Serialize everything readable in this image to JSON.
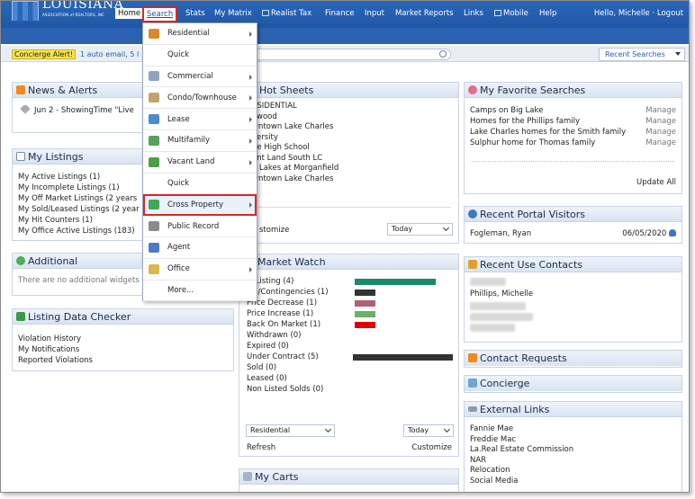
{
  "logo": {
    "name": "LOUISIANA",
    "tagline": "ASSOCIATION of REALTORS, INC"
  },
  "nav": {
    "home": "Home",
    "search": "Search",
    "stats": "Stats",
    "my_matrix": "My Matrix",
    "realist_tax": "Realist Tax",
    "finance": "Finance",
    "input": "Input",
    "market_reports": "Market Reports",
    "links": "Links",
    "mobile": "Mobile",
    "help": "Help",
    "greeting": "Hello, Michelle · Logout"
  },
  "alert": {
    "badge": "Concierge Alert!",
    "text": "1 auto email, 5 l"
  },
  "search_box": {
    "placeholder": ""
  },
  "recent_searches": "Recent Searches",
  "menu": [
    {
      "label": "Residential",
      "icon": "house-icon",
      "submenu": true
    },
    {
      "label": "Quick",
      "icon": "",
      "submenu": false
    },
    {
      "label": "Commercial",
      "icon": "building-icon",
      "submenu": true
    },
    {
      "label": "Condo/Townhouse",
      "icon": "condo-icon",
      "submenu": true
    },
    {
      "label": "Lease",
      "icon": "lease-icon",
      "submenu": true
    },
    {
      "label": "Multifamily",
      "icon": "multifamily-icon",
      "submenu": true
    },
    {
      "label": "Vacant Land",
      "icon": "tree-icon",
      "submenu": true
    },
    {
      "label": "Quick",
      "icon": "",
      "submenu": false
    },
    {
      "label": "Cross Property",
      "icon": "cross-arrows-icon",
      "submenu": true
    },
    {
      "label": "Public Record",
      "icon": "bank-icon",
      "submenu": false
    },
    {
      "label": "Agent",
      "icon": "agent-icon",
      "submenu": false
    },
    {
      "label": "Office",
      "icon": "office-icon",
      "submenu": true
    },
    {
      "label": "More...",
      "icon": "",
      "submenu": false
    }
  ],
  "news": {
    "title": "News & Alerts",
    "item": "Jun 2 - ShowingTime \"Live"
  },
  "listings": {
    "title": "My Listings",
    "items": [
      "My Active Listings (1)",
      "My Incomplete Listings (1)",
      "My Off Market Listings (2 years",
      "My Sold/Leased Listings (2 year",
      "My Hit Counters (1)",
      "My Office Active Listings (183)"
    ]
  },
  "additional": {
    "title": "Additional",
    "text": "There are no additional widgets"
  },
  "checker": {
    "title": "Listing Data Checker",
    "items": [
      "Violation History",
      "My Notifications",
      "Reported Violations"
    ]
  },
  "hotsheets": {
    "title": "Hot Sheets",
    "items": [
      "ESIDENTIAL",
      "ywood",
      "wntown Lake Charles",
      "versity",
      "be High School",
      "ant Land South LC",
      "e Lakes at Morganfield",
      "wntown Lake Charles"
    ],
    "customize": "stomize",
    "period": "Today"
  },
  "market": {
    "title": "Market Watch",
    "rows": [
      {
        "label": "w Listing (4)",
        "bar": 0.72,
        "color": "#1a8a6a"
      },
      {
        "label": "ive/Contingencies (1)",
        "bar": 0.18,
        "color": "#333333"
      },
      {
        "label": "Price Decrease (1)",
        "bar": 0.18,
        "color": "#b06070"
      },
      {
        "label": "Price Increase (1)",
        "bar": 0.18,
        "color": "#6ab06a"
      },
      {
        "label": "Back On Market (1)",
        "bar": 0.18,
        "color": "#e00000"
      },
      {
        "label": "Withdrawn (0)",
        "bar": 0,
        "color": "#333333"
      },
      {
        "label": "Expired (0)",
        "bar": 0,
        "color": "#333333"
      },
      {
        "label": "Under Contract (5)",
        "bar": 0.9,
        "color": "#333333"
      },
      {
        "label": "Sold (0)",
        "bar": 0,
        "color": "#333333"
      },
      {
        "label": "Leased (0)",
        "bar": 0,
        "color": "#333333"
      },
      {
        "label": "Non Listed Solds (0)",
        "bar": 0,
        "color": "#333333"
      }
    ],
    "type_select": "Residential",
    "period_select": "Today",
    "refresh": "Refresh",
    "customize": "Customize"
  },
  "carts": {
    "title": "My Carts"
  },
  "favorites": {
    "title": "My Favorite Searches",
    "items": [
      "Camps on Big Lake",
      "Homes for the Phillips family",
      "Lake Charles homes for the Smith family",
      "Sulphur home for Thomas family"
    ],
    "manage": "Manage",
    "update_all": "Update All"
  },
  "visitors": {
    "title": "Recent Portal Visitors",
    "name": "Fogleman, Ryan",
    "date": "06/05/2020"
  },
  "contacts": {
    "title": "Recent Use Contacts",
    "name": "Phillips, Michelle"
  },
  "requests": {
    "title": "Contact Requests"
  },
  "concierge": {
    "title": "Concierge"
  },
  "external": {
    "title": "External Links",
    "items": [
      "Fannie Mae",
      "Freddie Mac",
      "La.Real Estate Commission",
      "NAR",
      "Relocation",
      "Social Media"
    ]
  },
  "colors": {
    "nav_blue": "#1a4f9c",
    "highlight_red": "#d12b2b"
  }
}
